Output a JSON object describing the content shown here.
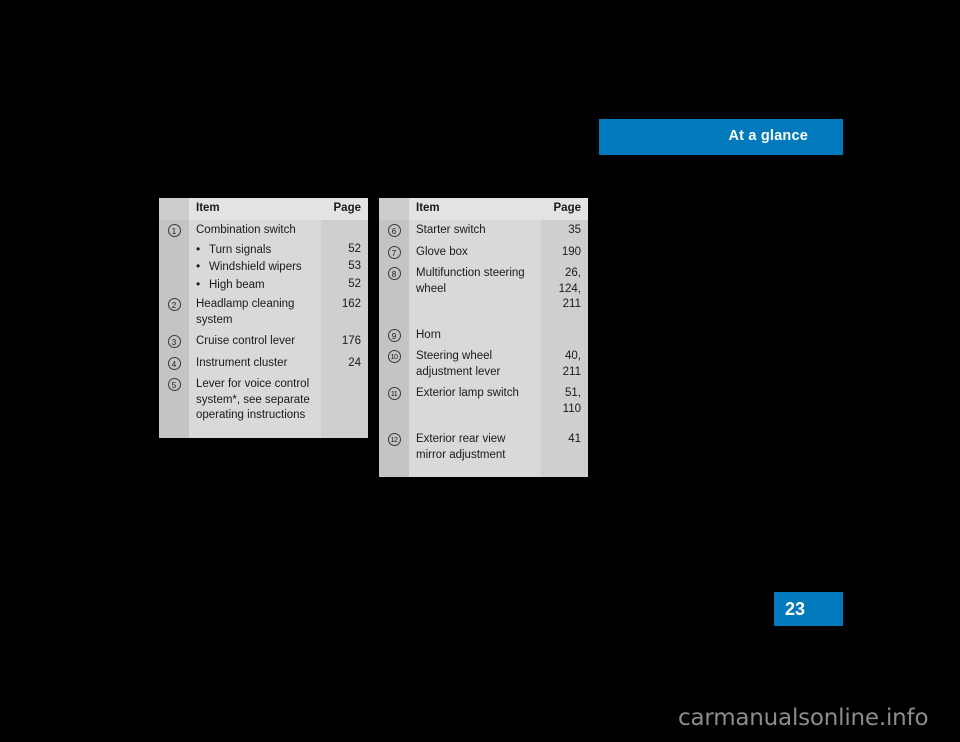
{
  "header": {
    "title": "At a glance",
    "accent_color": "#0079bd"
  },
  "page_number": {
    "value": "23",
    "box_color": "#0079bd"
  },
  "footer": {
    "watermark": "carmanualsonline.info"
  },
  "tables": {
    "left": {
      "headers": {
        "num": "",
        "item": "Item",
        "page": "Page"
      },
      "rows": [
        {
          "num": "1",
          "item": "Combination switch",
          "page": ""
        },
        {
          "bullet": true,
          "item": "Turn signals",
          "page": "52"
        },
        {
          "bullet": true,
          "item": "Windshield wipers",
          "page": "53"
        },
        {
          "bullet": true,
          "item": "High beam",
          "page": "52"
        },
        {
          "num": "2",
          "item": "Headlamp cleaning system",
          "page": "162"
        },
        {
          "num": "3",
          "item": "Cruise control lever",
          "page": "176"
        },
        {
          "num": "4",
          "item": "Instrument cluster",
          "page": "24"
        },
        {
          "num": "5",
          "item": "Lever for voice control system*, see separate operating instructions",
          "page": ""
        }
      ]
    },
    "right": {
      "headers": {
        "num": "",
        "item": "Item",
        "page": "Page"
      },
      "rows": [
        {
          "num": "6",
          "item": "Starter switch",
          "page": "35"
        },
        {
          "num": "7",
          "item": "Glove box",
          "page": "190"
        },
        {
          "num": "8",
          "item": "Multifunction steering wheel",
          "page": "26,\n124,\n211"
        },
        {
          "num": "9",
          "item": "Horn",
          "page": ""
        },
        {
          "num": "10",
          "item": "Steering wheel adjustment lever",
          "page": "40,\n211"
        },
        {
          "num": "11",
          "item": "Exterior lamp switch",
          "page": "51,\n110"
        },
        {
          "num": "12",
          "item": "Exterior rear view mirror adjustment",
          "page": "41"
        }
      ]
    }
  },
  "bullet_glyph": "•"
}
